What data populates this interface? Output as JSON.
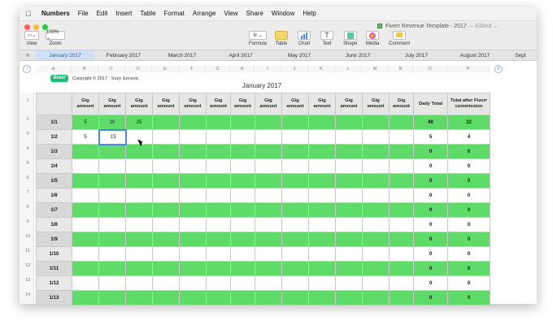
{
  "menubar": {
    "app": "Numbers",
    "items": [
      "File",
      "Edit",
      "Insert",
      "Table",
      "Format",
      "Arrange",
      "View",
      "Share",
      "Window",
      "Help"
    ]
  },
  "window": {
    "title": "Fiverr Revenue Template - 2017",
    "edited": "— Edited ⌄"
  },
  "toolbar": {
    "view": "View",
    "zoom_value": "100% ⌄",
    "zoom": "Zoom",
    "formula_icon": "fx ⌄",
    "formula": "Formula",
    "table": "Table",
    "chart": "Chart",
    "text_icon": "T",
    "text": "Text",
    "shape": "Shape",
    "media": "Media",
    "comment": "Comment"
  },
  "tabs": {
    "add": "+",
    "items": [
      "January 2017",
      "February 2017",
      "March 2017",
      "April 2017",
      "May 2017",
      "June 2017",
      "July 2017",
      "August 2017",
      "Sept"
    ]
  },
  "colors": {
    "green_row": "#5fdb6a",
    "fiverr_brand": "#1dbf73",
    "selection": "#4a86e8",
    "active_tab_bg": "#cfe0f4"
  },
  "column_letters": [
    "A",
    "B",
    "C",
    "D",
    "E",
    "F",
    "G",
    "H",
    "I",
    "J",
    "K",
    "L",
    "M",
    "N",
    "O",
    "P"
  ],
  "sheet": {
    "logo": "fiverr",
    "copyright": "Copyright © 2017 · Suzy Jurcevic",
    "title": "January 2017"
  },
  "table": {
    "headers": [
      "",
      "Gig amount",
      "Gig amount",
      "Gig amount",
      "Gig amount",
      "Gig amount",
      "Gig amount",
      "Gig amount",
      "Gig amount",
      "Gig amount",
      "Gig amount",
      "Gig amount",
      "Gig amount",
      "Gig amount",
      "Daily Total",
      "Total after Fiverr commission"
    ],
    "row_numbers": [
      "1",
      "2",
      "3",
      "4",
      "5",
      "6",
      "7",
      "8",
      "9",
      "10",
      "11",
      "12",
      "13",
      "14"
    ],
    "rows": [
      {
        "date": "1/1",
        "gigs": [
          "5",
          "10",
          "25",
          "",
          "",
          "",
          "",
          "",
          "",
          "",
          "",
          "",
          ""
        ],
        "daily": "40",
        "after": "32"
      },
      {
        "date": "1/2",
        "gigs": [
          "5",
          "15",
          "",
          "",
          "",
          "",
          "",
          "",
          "",
          "",
          "",
          "",
          ""
        ],
        "daily": "5",
        "after": "4"
      },
      {
        "date": "1/3",
        "gigs": [
          "",
          "",
          "",
          "",
          "",
          "",
          "",
          "",
          "",
          "",
          "",
          "",
          ""
        ],
        "daily": "0",
        "after": "0"
      },
      {
        "date": "1/4",
        "gigs": [
          "",
          "",
          "",
          "",
          "",
          "",
          "",
          "",
          "",
          "",
          "",
          "",
          ""
        ],
        "daily": "0",
        "after": "0"
      },
      {
        "date": "1/5",
        "gigs": [
          "",
          "",
          "",
          "",
          "",
          "",
          "",
          "",
          "",
          "",
          "",
          "",
          ""
        ],
        "daily": "0",
        "after": "0"
      },
      {
        "date": "1/6",
        "gigs": [
          "",
          "",
          "",
          "",
          "",
          "",
          "",
          "",
          "",
          "",
          "",
          "",
          ""
        ],
        "daily": "0",
        "after": "0"
      },
      {
        "date": "1/7",
        "gigs": [
          "",
          "",
          "",
          "",
          "",
          "",
          "",
          "",
          "",
          "",
          "",
          "",
          ""
        ],
        "daily": "0",
        "after": "0"
      },
      {
        "date": "1/8",
        "gigs": [
          "",
          "",
          "",
          "",
          "",
          "",
          "",
          "",
          "",
          "",
          "",
          "",
          ""
        ],
        "daily": "0",
        "after": "0"
      },
      {
        "date": "1/9",
        "gigs": [
          "",
          "",
          "",
          "",
          "",
          "",
          "",
          "",
          "",
          "",
          "",
          "",
          ""
        ],
        "daily": "0",
        "after": "0"
      },
      {
        "date": "1/10",
        "gigs": [
          "",
          "",
          "",
          "",
          "",
          "",
          "",
          "",
          "",
          "",
          "",
          "",
          ""
        ],
        "daily": "0",
        "after": "0"
      },
      {
        "date": "1/11",
        "gigs": [
          "",
          "",
          "",
          "",
          "",
          "",
          "",
          "",
          "",
          "",
          "",
          "",
          ""
        ],
        "daily": "0",
        "after": "0"
      },
      {
        "date": "1/12",
        "gigs": [
          "",
          "",
          "",
          "",
          "",
          "",
          "",
          "",
          "",
          "",
          "",
          "",
          ""
        ],
        "daily": "0",
        "after": "0"
      },
      {
        "date": "1/13",
        "gigs": [
          "",
          "",
          "",
          "",
          "",
          "",
          "",
          "",
          "",
          "",
          "",
          "",
          ""
        ],
        "daily": "0",
        "after": "0"
      }
    ]
  }
}
